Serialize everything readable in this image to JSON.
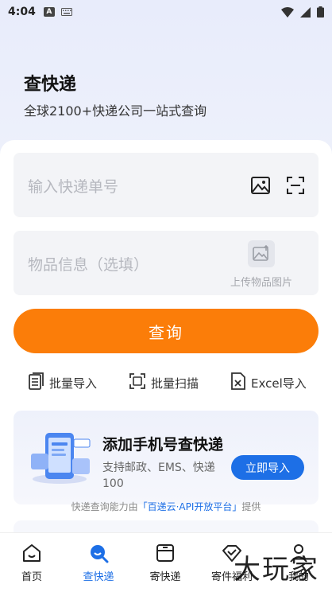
{
  "status_bar": {
    "time": "4:04"
  },
  "header": {
    "title": "查快递",
    "subtitle": "全球2100+快递公司一站式查询"
  },
  "search": {
    "tracking_placeholder": "输入快递单号",
    "info_placeholder": "物品信息（选填）",
    "upload_label": "上传物品图片",
    "query_button": "查询"
  },
  "tools": [
    {
      "label": "批量导入",
      "icon": "document-list-icon"
    },
    {
      "label": "批量扫描",
      "icon": "scan-frame-icon"
    },
    {
      "label": "Excel导入",
      "icon": "excel-icon"
    }
  ],
  "promo": {
    "title": "添加手机号查快递",
    "description": "支持邮政、EMS、快递100",
    "button": "立即导入"
  },
  "footnote": {
    "prefix": "快递查询能力由",
    "highlight": "「百递云·API开放平台」",
    "suffix": "提供"
  },
  "bottom_nav": [
    {
      "label": "首页",
      "icon": "home-icon",
      "active": false
    },
    {
      "label": "查快递",
      "icon": "search-package-icon",
      "active": true
    },
    {
      "label": "寄快递",
      "icon": "box-icon",
      "active": false
    },
    {
      "label": "寄件福利",
      "icon": "gift-icon",
      "active": false
    },
    {
      "label": "我的",
      "icon": "profile-icon",
      "active": false
    }
  ],
  "watermark": "大玩家",
  "colors": {
    "accent_orange": "#fb7d09",
    "accent_blue": "#1d6fe6",
    "placeholder_gray": "#b6b8bf"
  }
}
